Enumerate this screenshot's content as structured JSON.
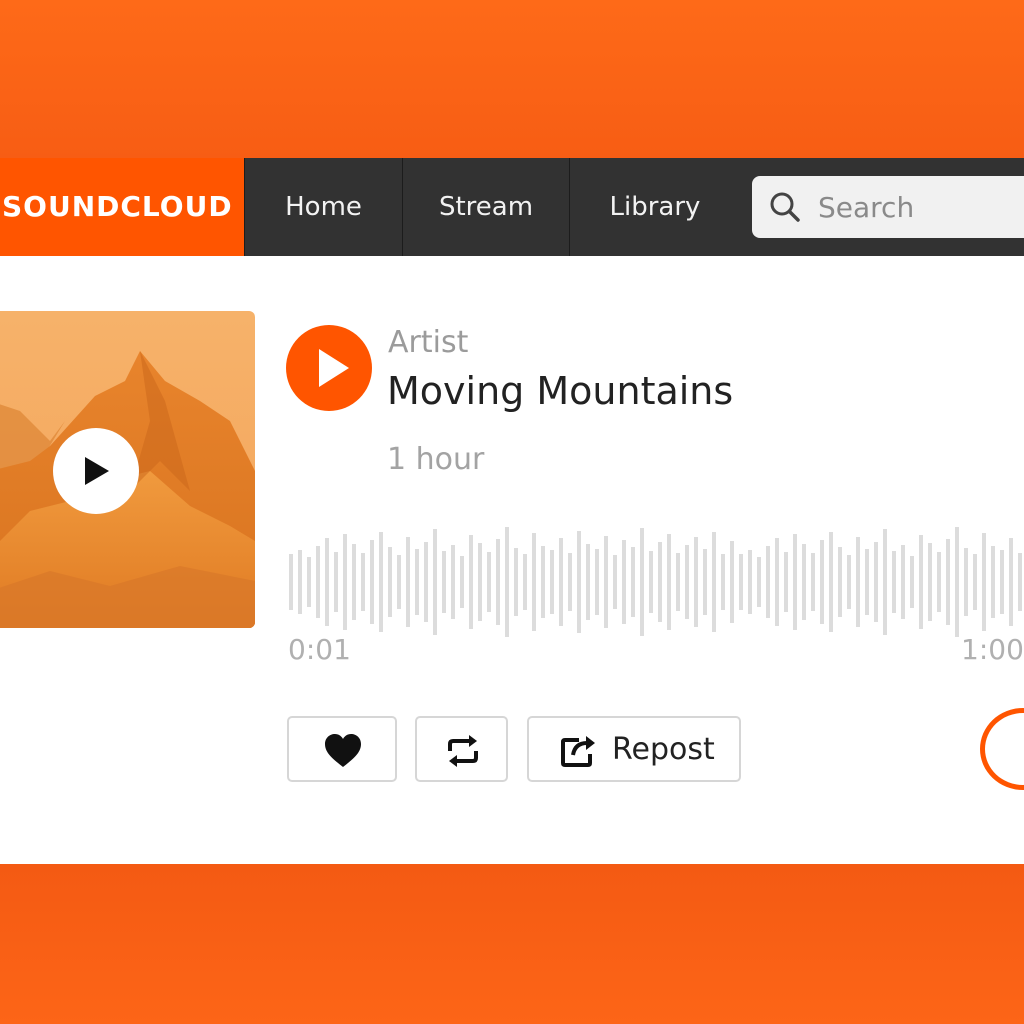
{
  "brand": {
    "name": "SOUNDCLOUD",
    "accent": "#ff5500"
  },
  "nav": {
    "items": [
      {
        "label": "Home"
      },
      {
        "label": "Stream"
      },
      {
        "label": "Library"
      }
    ]
  },
  "search": {
    "placeholder": "Search",
    "icon": "search-icon"
  },
  "track": {
    "artist": "Artist",
    "title": "Moving Mountains",
    "posted": "1 hour",
    "time_start": "0:01",
    "time_end": "1:00"
  },
  "actions": {
    "like_icon": "heart-icon",
    "repost_icon": "repost-icon",
    "share_label": "Repost",
    "share_icon": "share-icon"
  }
}
